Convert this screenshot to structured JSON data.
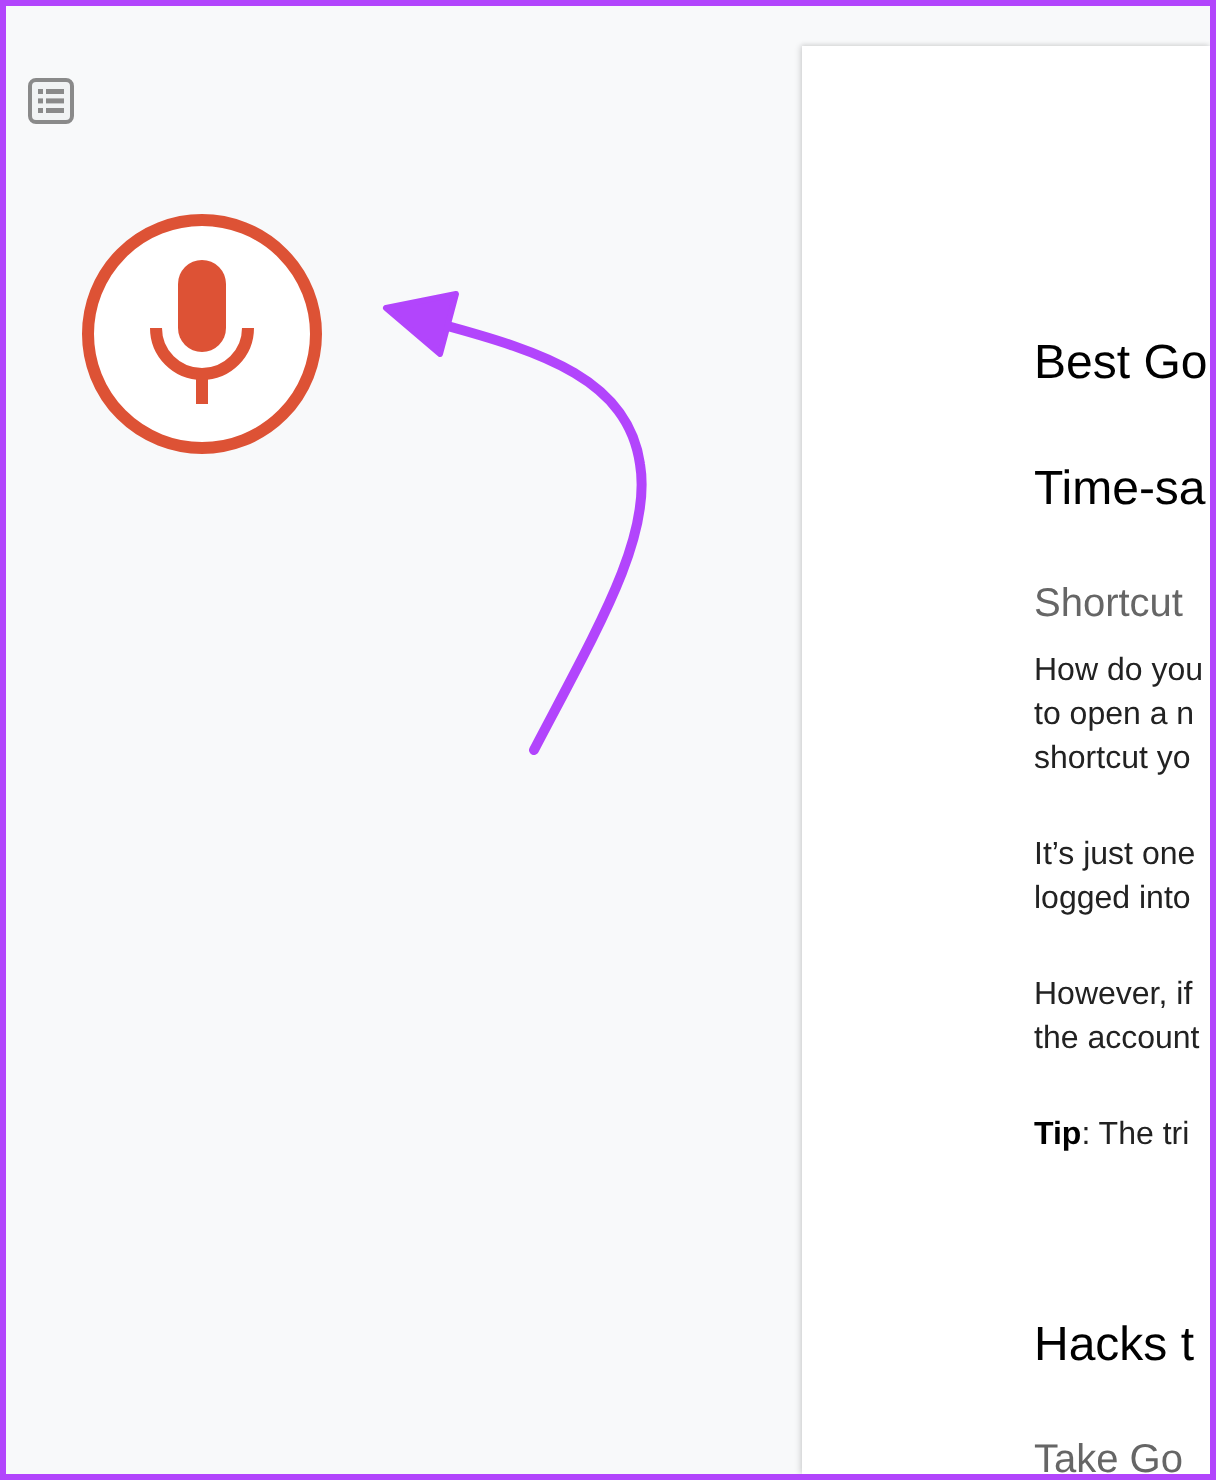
{
  "voice_typing": {
    "listening": true
  },
  "document": {
    "blocks": [
      {
        "kind": "heading",
        "text": "Best Go"
      },
      {
        "kind": "heading",
        "text": "Time-sa"
      },
      {
        "kind": "subheading",
        "text": "Shortcut"
      },
      {
        "kind": "paragraph",
        "lines": [
          "How do you",
          "to open a n",
          "shortcut yo"
        ]
      },
      {
        "kind": "paragraph",
        "lines": [
          "It’s just one",
          "logged into"
        ]
      },
      {
        "kind": "paragraph",
        "lines": [
          "However, if",
          "the account"
        ]
      },
      {
        "kind": "paragraph",
        "lines": [
          "**Tip**: The tri"
        ]
      },
      {
        "kind": "heading",
        "text": "Hacks t"
      },
      {
        "kind": "subheading",
        "text": "Take Go"
      }
    ]
  }
}
